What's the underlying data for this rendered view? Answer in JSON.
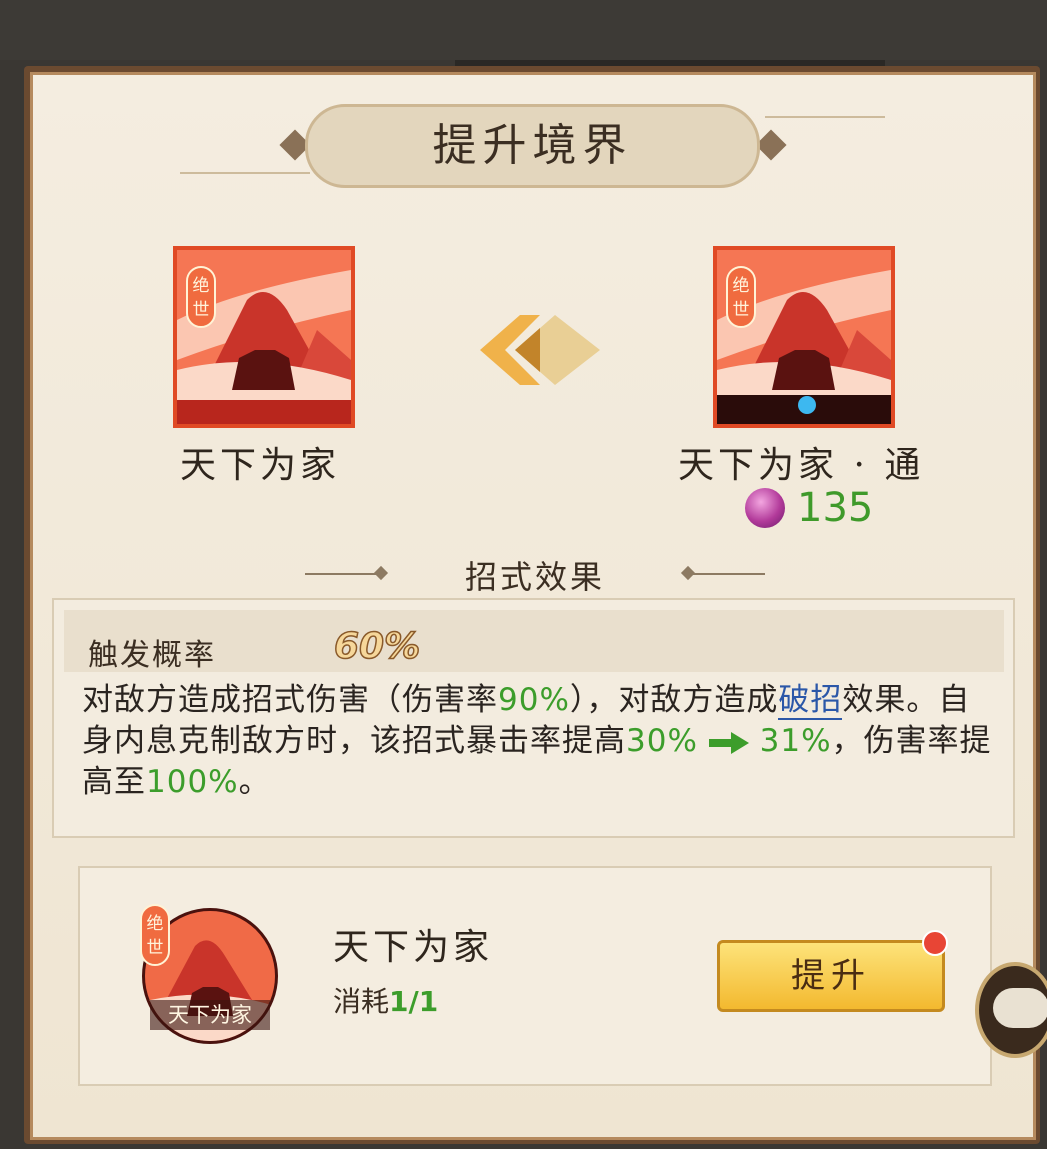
{
  "title": "提升境界",
  "from_skill": {
    "name": "天下为家",
    "badge": "绝世"
  },
  "to_skill": {
    "name": "天下为家 · 通",
    "badge": "绝世",
    "cost_value": "135"
  },
  "section_title": "招式效果",
  "effect": {
    "trigger_label": "触发概率",
    "trigger_value": "60%",
    "desc_1": "对敌方造成招式伤害（伤害率",
    "val_dmg": "90%",
    "desc_2": "），对敌方造成",
    "link": "破招",
    "desc_3": "效果。自身内息克制敌方时，该招式暴击率提高",
    "val_crit_from": "30%",
    "val_crit_to": "31%",
    "desc_4": "，伤害率提高至",
    "val_dmg_to": "100%",
    "desc_5": "。"
  },
  "material": {
    "name": "天下为家",
    "ring_label": "天下为家",
    "badge": "绝世",
    "cost_label": "消耗",
    "cost_value": "1/1"
  },
  "upgrade_button": "提升",
  "colors": {
    "accent_green": "#3c9d2b",
    "card_red": "#f16037",
    "button_gold": "#f3b92f"
  },
  "icons": [
    "chevron-arrow-icon",
    "spirit-orb-icon",
    "chat-icon",
    "notification-dot-icon"
  ]
}
